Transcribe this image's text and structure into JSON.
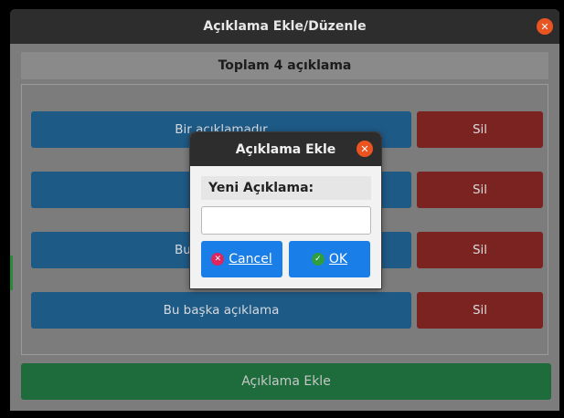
{
  "window": {
    "title": "Açıklama Ekle/Düzenle",
    "close_icon": "close-icon",
    "total_label": "Toplam 4 açıklama",
    "rows": [
      {
        "label": "Bir açıklamadır",
        "delete_label": "Sil"
      },
      {
        "label": "",
        "delete_label": "Sil"
      },
      {
        "label": "Bu",
        "delete_label": "Sil"
      },
      {
        "label": "Bu başka açıklama",
        "delete_label": "Sil"
      }
    ],
    "add_button": "Açıklama Ekle"
  },
  "dialog": {
    "title": "Açıklama Ekle",
    "field_label": "Yeni Açıklama:",
    "input_value": "",
    "cancel_label": "Cancel",
    "ok_label": "OK",
    "cancel_icon": "cancel-icon",
    "ok_icon": "check-icon"
  },
  "colors": {
    "titlebar": "#2d2d2d",
    "close_accent": "#e95420",
    "row_button": "#1e5a86",
    "delete_button": "#7a2320",
    "add_button": "#1e6b3b",
    "dialog_button": "#1a7ee8"
  }
}
